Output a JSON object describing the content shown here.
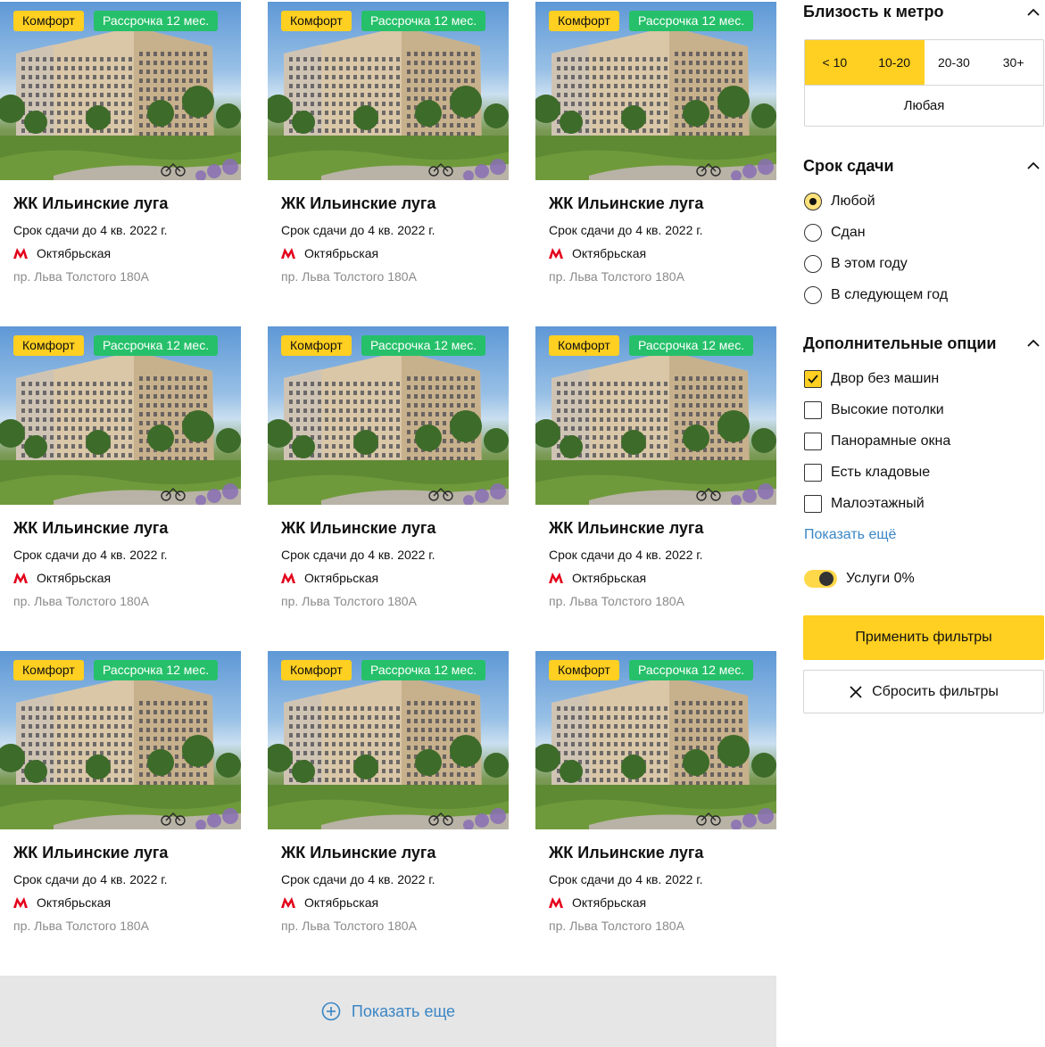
{
  "cards": [
    {
      "badges": {
        "class": "Комфорт",
        "installment": "Рассрочка 12 мес."
      },
      "title": "ЖК Ильинские луга",
      "deadline": "Срок сдачи до 4 кв. 2022 г.",
      "metro": "Октябрьская",
      "address": "пр. Льва Толстого 180А"
    },
    {
      "badges": {
        "class": "Комфорт",
        "installment": "Рассрочка 12 мес."
      },
      "title": "ЖК Ильинские луга",
      "deadline": "Срок сдачи до 4 кв. 2022 г.",
      "metro": "Октябрьская",
      "address": "пр. Льва Толстого 180А"
    },
    {
      "badges": {
        "class": "Комфорт",
        "installment": "Рассрочка 12 мес."
      },
      "title": "ЖК Ильинские луга",
      "deadline": "Срок сдачи до 4 кв. 2022 г.",
      "metro": "Октябрьская",
      "address": "пр. Льва Толстого 180А"
    },
    {
      "badges": {
        "class": "Комфорт",
        "installment": "Рассрочка 12 мес."
      },
      "title": "ЖК Ильинские луга",
      "deadline": "Срок сдачи до 4 кв. 2022 г.",
      "metro": "Октябрьская",
      "address": "пр. Льва Толстого 180А"
    },
    {
      "badges": {
        "class": "Комфорт",
        "installment": "Рассрочка 12 мес."
      },
      "title": "ЖК Ильинские луга",
      "deadline": "Срок сдачи до 4 кв. 2022 г.",
      "metro": "Октябрьская",
      "address": "пр. Льва Толстого 180А"
    },
    {
      "badges": {
        "class": "Комфорт",
        "installment": "Рассрочка 12 мес."
      },
      "title": "ЖК Ильинские луга",
      "deadline": "Срок сдачи до 4 кв. 2022 г.",
      "metro": "Октябрьская",
      "address": "пр. Льва Толстого 180А"
    },
    {
      "badges": {
        "class": "Комфорт",
        "installment": "Рассрочка 12 мес."
      },
      "title": "ЖК Ильинские луга",
      "deadline": "Срок сдачи до 4 кв. 2022 г.",
      "metro": "Октябрьская",
      "address": "пр. Льва Толстого 180А"
    },
    {
      "badges": {
        "class": "Комфорт",
        "installment": "Рассрочка 12 мес."
      },
      "title": "ЖК Ильинские луга",
      "deadline": "Срок сдачи до 4 кв. 2022 г.",
      "metro": "Октябрьская",
      "address": "пр. Льва Толстого 180А"
    },
    {
      "badges": {
        "class": "Комфорт",
        "installment": "Рассрочка 12 мес."
      },
      "title": "ЖК Ильинские луга",
      "deadline": "Срок сдачи до 4 кв. 2022 г.",
      "metro": "Октябрьская",
      "address": "пр. Льва Толстого 180А"
    }
  ],
  "show_more": {
    "label": "Показать еще",
    "icon": "plus-circle-icon"
  },
  "filters": {
    "metro": {
      "title": "Близость к метро",
      "options": [
        "< 10",
        "10-20",
        "20-30",
        "30+"
      ],
      "selected": [
        "< 10",
        "10-20"
      ],
      "any_label": "Любая"
    },
    "deadline": {
      "title": "Срок сдачи",
      "options": [
        "Любой",
        "Сдан",
        "В этом году",
        "В следующем год"
      ],
      "selected": "Любой"
    },
    "extra": {
      "title": "Дополнительные опции",
      "options": [
        "Двор без машин",
        "Высокие потолки",
        "Панорамные окна",
        "Есть кладовые",
        "Малоэтажный"
      ],
      "checked": [
        "Двор без машин"
      ],
      "show_more_label": "Показать ещё"
    },
    "services_toggle": {
      "label": "Услуги 0%",
      "on": true
    },
    "apply_label": "Применить фильтры",
    "reset_label": "Сбросить фильтры"
  },
  "colors": {
    "accent_yellow": "#ffcf21",
    "badge_green": "#26c06a",
    "link_blue": "#3a86c5",
    "metro_red": "#e3001b"
  }
}
